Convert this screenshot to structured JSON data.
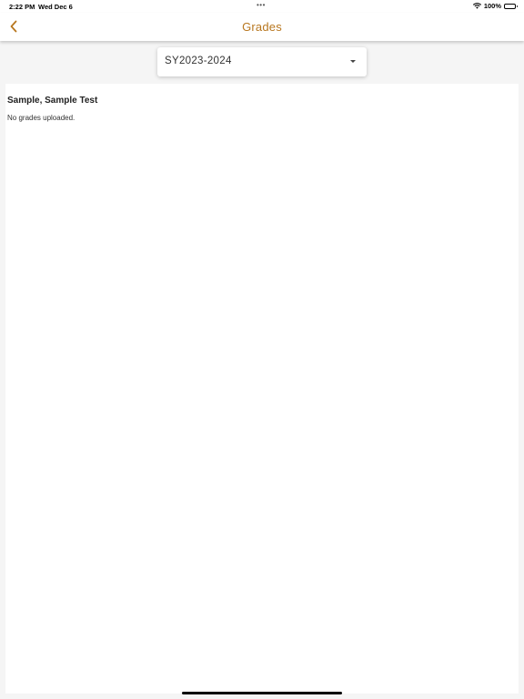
{
  "status_bar": {
    "time": "2:22 PM",
    "date": "Wed Dec 6",
    "multitask_dots": "•••",
    "battery_percent": "100%",
    "battery_level": 1.0
  },
  "nav": {
    "title": "Grades",
    "back_icon": "chevron-left-icon",
    "accent_color": "#b8771f"
  },
  "year_select": {
    "selected": "SY2023-2024",
    "caret_icon": "caret-down-icon"
  },
  "student": {
    "name": "Sample, Sample Test",
    "empty_message": "No grades uploaded."
  }
}
